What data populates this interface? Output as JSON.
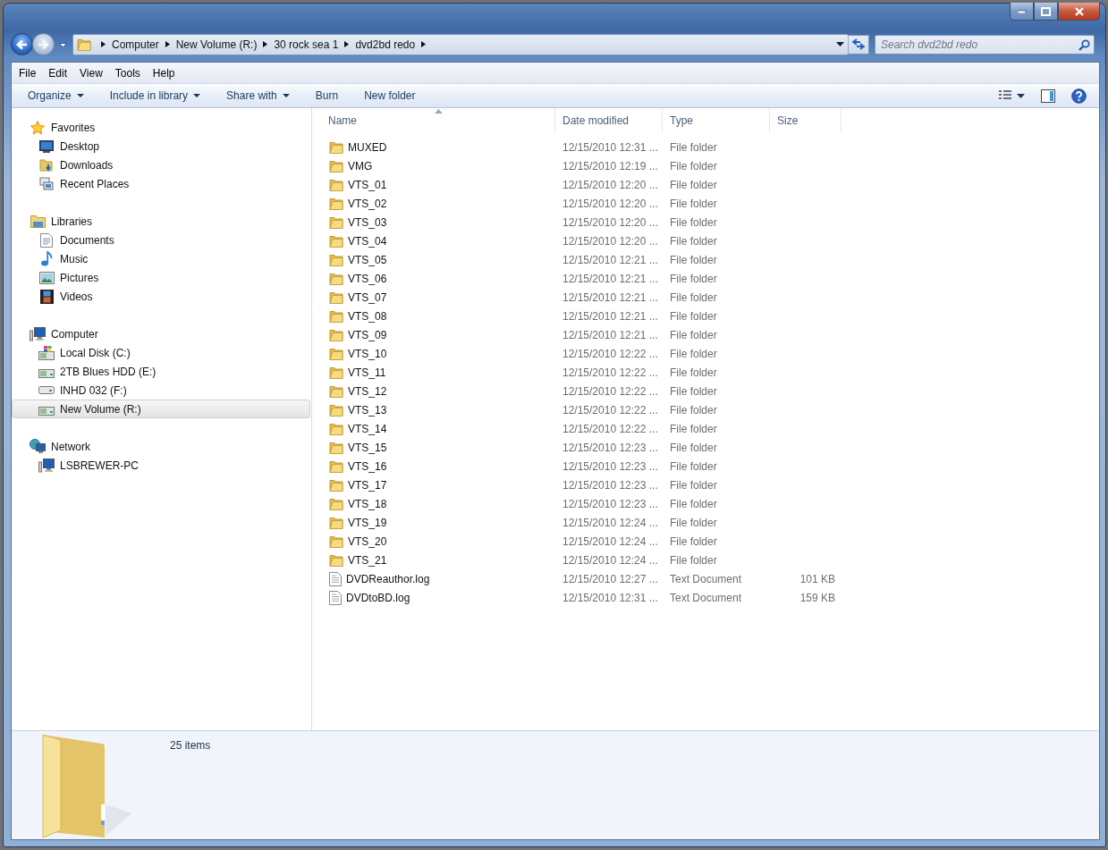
{
  "address_bar": {
    "crumbs": [
      "Computer",
      "New Volume (R:)",
      "30 rock sea 1",
      "dvd2bd redo"
    ]
  },
  "search": {
    "placeholder": "Search dvd2bd redo"
  },
  "menu": [
    "File",
    "Edit",
    "View",
    "Tools",
    "Help"
  ],
  "toolbar": [
    {
      "label": "Organize",
      "dropdown": true
    },
    {
      "label": "Include in library",
      "dropdown": true
    },
    {
      "label": "Share with",
      "dropdown": true
    },
    {
      "label": "Burn",
      "dropdown": false
    },
    {
      "label": "New folder",
      "dropdown": false
    }
  ],
  "sidebar": [
    {
      "label": "Favorites",
      "kind": "favorites",
      "items": [
        {
          "label": "Desktop",
          "kind": "desktop",
          "selected": false
        },
        {
          "label": "Downloads",
          "kind": "downloads",
          "selected": false
        },
        {
          "label": "Recent Places",
          "kind": "recent",
          "selected": false
        }
      ]
    },
    {
      "label": "Libraries",
      "kind": "libraries",
      "items": [
        {
          "label": "Documents",
          "kind": "documents",
          "selected": false
        },
        {
          "label": "Music",
          "kind": "music",
          "selected": false
        },
        {
          "label": "Pictures",
          "kind": "pictures",
          "selected": false
        },
        {
          "label": "Videos",
          "kind": "videos",
          "selected": false
        }
      ]
    },
    {
      "label": "Computer",
      "kind": "computer",
      "items": [
        {
          "label": "Local Disk (C:)",
          "kind": "system_drive",
          "selected": false
        },
        {
          "label": "2TB Blues HDD (E:)",
          "kind": "drive",
          "selected": false
        },
        {
          "label": "INHD 032 (F:)",
          "kind": "removable",
          "selected": false
        },
        {
          "label": "New Volume (R:)",
          "kind": "drive",
          "selected": true
        }
      ]
    },
    {
      "label": "Network",
      "kind": "network",
      "items": [
        {
          "label": "LSBREWER-PC",
          "kind": "pc",
          "selected": false
        }
      ]
    }
  ],
  "table": {
    "columns": [
      {
        "label": "Name",
        "sorted": true
      },
      {
        "label": "Date modified",
        "sorted": false
      },
      {
        "label": "Type",
        "sorted": false
      },
      {
        "label": "Size",
        "sorted": false
      }
    ],
    "rows": [
      {
        "kind": "folder",
        "name": "MUXED",
        "date": "12/15/2010 12:31 ...",
        "type": "File folder"
      },
      {
        "kind": "folder",
        "name": "VMG",
        "date": "12/15/2010 12:19 ...",
        "type": "File folder"
      },
      {
        "kind": "folder",
        "name": "VTS_01",
        "date": "12/15/2010 12:20 ...",
        "type": "File folder"
      },
      {
        "kind": "folder",
        "name": "VTS_02",
        "date": "12/15/2010 12:20 ...",
        "type": "File folder"
      },
      {
        "kind": "folder",
        "name": "VTS_03",
        "date": "12/15/2010 12:20 ...",
        "type": "File folder"
      },
      {
        "kind": "folder",
        "name": "VTS_04",
        "date": "12/15/2010 12:20 ...",
        "type": "File folder"
      },
      {
        "kind": "folder",
        "name": "VTS_05",
        "date": "12/15/2010 12:21 ...",
        "type": "File folder"
      },
      {
        "kind": "folder",
        "name": "VTS_06",
        "date": "12/15/2010 12:21 ...",
        "type": "File folder"
      },
      {
        "kind": "folder",
        "name": "VTS_07",
        "date": "12/15/2010 12:21 ...",
        "type": "File folder"
      },
      {
        "kind": "folder",
        "name": "VTS_08",
        "date": "12/15/2010 12:21 ...",
        "type": "File folder"
      },
      {
        "kind": "folder",
        "name": "VTS_09",
        "date": "12/15/2010 12:21 ...",
        "type": "File folder"
      },
      {
        "kind": "folder",
        "name": "VTS_10",
        "date": "12/15/2010 12:22 ...",
        "type": "File folder"
      },
      {
        "kind": "folder",
        "name": "VTS_11",
        "date": "12/15/2010 12:22 ...",
        "type": "File folder"
      },
      {
        "kind": "folder",
        "name": "VTS_12",
        "date": "12/15/2010 12:22 ...",
        "type": "File folder"
      },
      {
        "kind": "folder",
        "name": "VTS_13",
        "date": "12/15/2010 12:22 ...",
        "type": "File folder"
      },
      {
        "kind": "folder",
        "name": "VTS_14",
        "date": "12/15/2010 12:22 ...",
        "type": "File folder"
      },
      {
        "kind": "folder",
        "name": "VTS_15",
        "date": "12/15/2010 12:23 ...",
        "type": "File folder"
      },
      {
        "kind": "folder",
        "name": "VTS_16",
        "date": "12/15/2010 12:23 ...",
        "type": "File folder"
      },
      {
        "kind": "folder",
        "name": "VTS_17",
        "date": "12/15/2010 12:23 ...",
        "type": "File folder"
      },
      {
        "kind": "folder",
        "name": "VTS_18",
        "date": "12/15/2010 12:23 ...",
        "type": "File folder"
      },
      {
        "kind": "folder",
        "name": "VTS_19",
        "date": "12/15/2010 12:24 ...",
        "type": "File folder"
      },
      {
        "kind": "folder",
        "name": "VTS_20",
        "date": "12/15/2010 12:24 ...",
        "type": "File folder"
      },
      {
        "kind": "folder",
        "name": "VTS_21",
        "date": "12/15/2010 12:24 ...",
        "type": "File folder"
      },
      {
        "kind": "text",
        "name": "DVDReauthor.log",
        "date": "12/15/2010 12:27 ...",
        "type": "Text Document",
        "size": "101 KB"
      },
      {
        "kind": "text",
        "name": "DVDtoBD.log",
        "date": "12/15/2010 12:31 ...",
        "type": "Text Document",
        "size": "159 KB"
      }
    ]
  },
  "details": {
    "count": "25 items"
  }
}
